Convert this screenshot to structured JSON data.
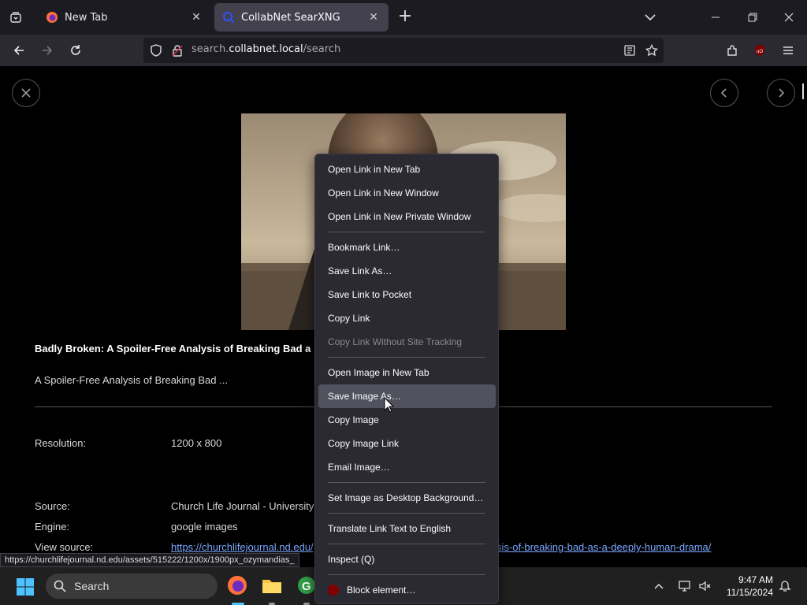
{
  "tabs": [
    {
      "title": "New Tab",
      "close": "✕"
    },
    {
      "title": "CollabNet SearXNG",
      "close": "✕"
    }
  ],
  "newtab": "+",
  "url": {
    "prefix": "search.",
    "domain": "collabnet.local",
    "path": "/search"
  },
  "result": {
    "title": "Badly Broken: A Spoiler-Free Analysis of Breaking Bad a",
    "description": "A Spoiler-Free Analysis of Breaking Bad ...",
    "resolution_label": "Resolution:",
    "resolution_value": "1200 x 800",
    "source_label": "Source:",
    "source_value": "Church Life Journal - University",
    "engine_label": "Engine:",
    "engine_value": "google images",
    "viewsource_label": "View source:",
    "viewsource_link_start": "https://churchlifejournal.nd.edu/",
    "viewsource_link_end": "sis-of-breaking-bad-as-a-deeply-human-drama/"
  },
  "status_url": "https://churchlifejournal.nd.edu/assets/515222/1200x/1900px_ozymandias_",
  "context_menu": {
    "items": [
      "Open Link in New Tab",
      "Open Link in New Window",
      "Open Link in New Private Window",
      "Bookmark Link…",
      "Save Link As…",
      "Save Link to Pocket",
      "Copy Link",
      "Copy Link Without Site Tracking",
      "Open Image in New Tab",
      "Save Image As…",
      "Copy Image",
      "Copy Image Link",
      "Email Image…",
      "Set Image as Desktop Background…",
      "Translate Link Text to English",
      "Inspect (Q)",
      "Block element…"
    ],
    "highlighted": "Save Image As…",
    "disabled": "Copy Link Without Site Tracking"
  },
  "taskbar": {
    "search_placeholder": "Search",
    "time": "9:47 AM",
    "date": "11/15/2024"
  },
  "colors": {
    "accent_link": "#7aa7ff",
    "menu_bg": "#2b2a33",
    "ublock": "#800000"
  }
}
